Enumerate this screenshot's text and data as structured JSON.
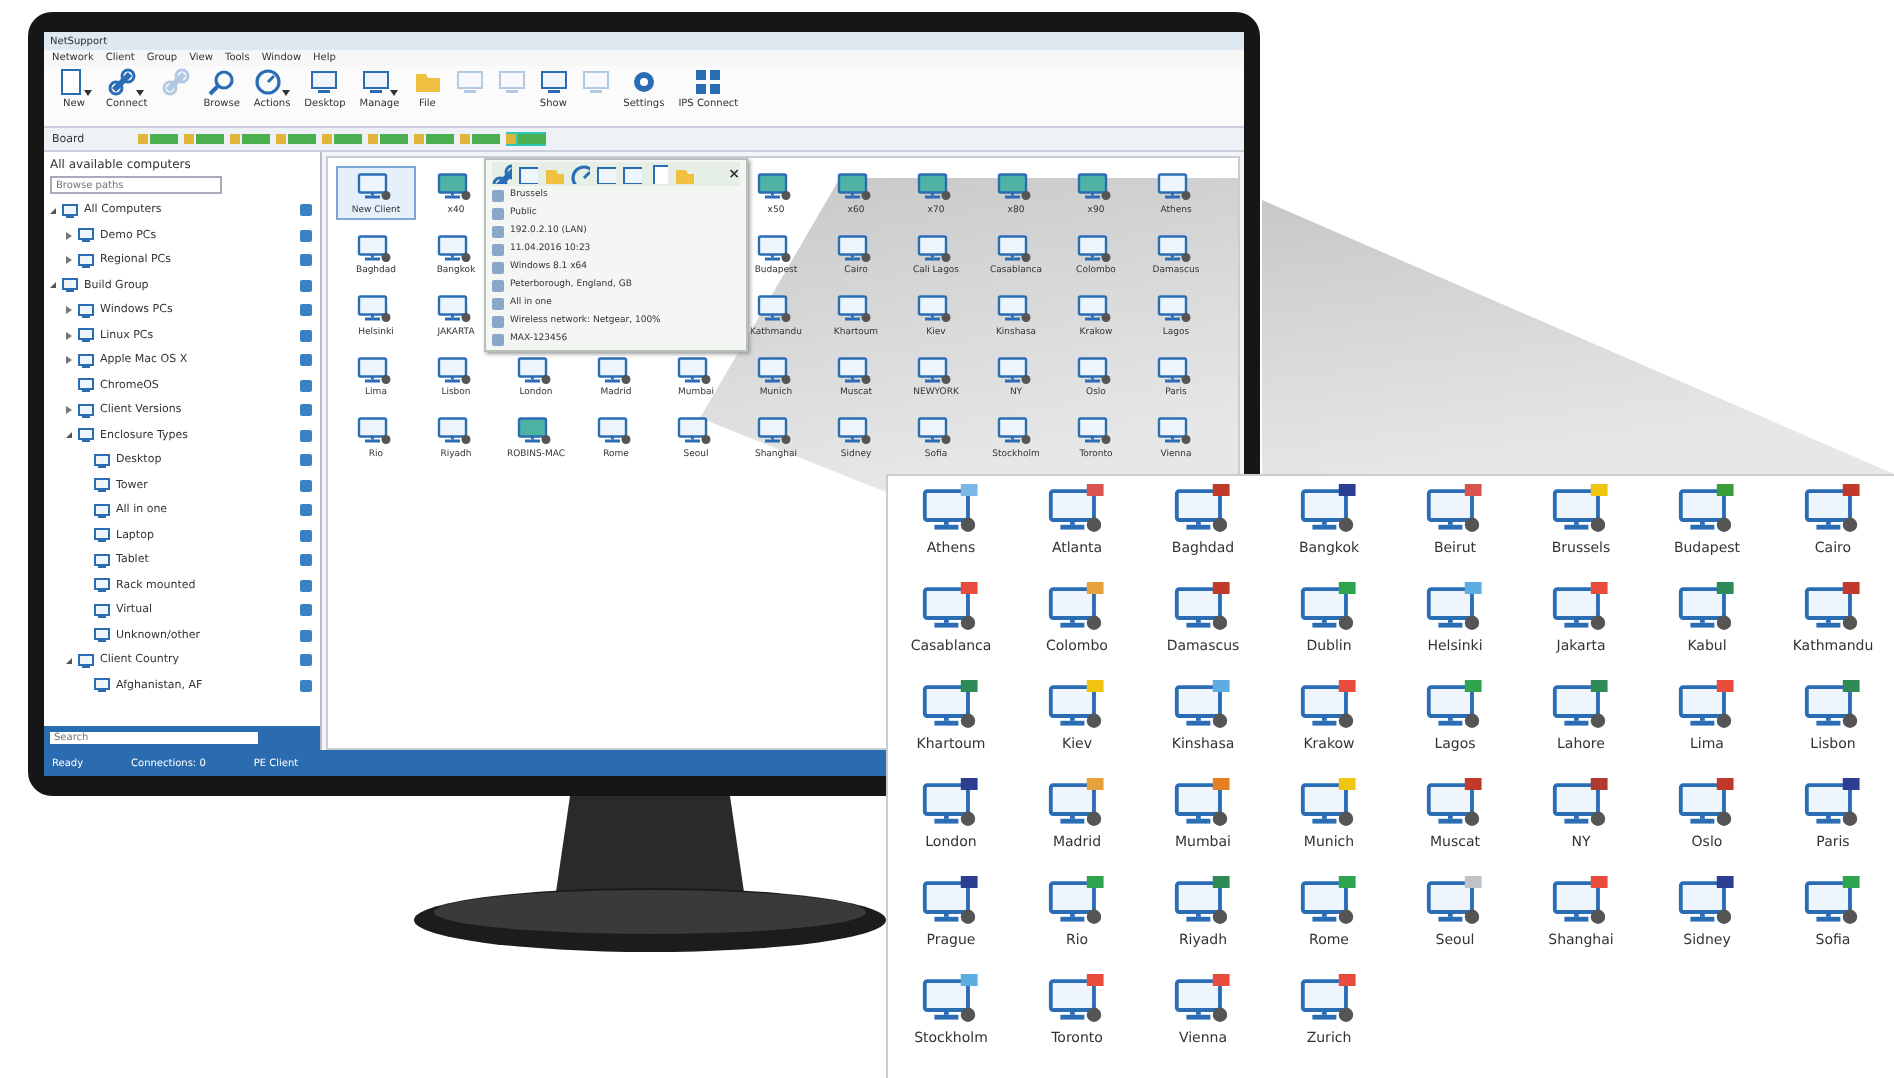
{
  "window": {
    "title": "NetSupport"
  },
  "menu": [
    "Network",
    "Client",
    "Group",
    "View",
    "Tools",
    "Window",
    "Help"
  ],
  "toolbar": [
    {
      "label": "New",
      "caret": true,
      "disabled": false
    },
    {
      "label": "Connect",
      "caret": true,
      "disabled": false
    },
    {
      "caret": false,
      "disabled": true
    },
    {
      "label": "Browse",
      "caret": false,
      "disabled": false
    },
    {
      "label": "Actions",
      "caret": true,
      "disabled": false
    },
    {
      "label": "Desktop",
      "caret": false,
      "disabled": false
    },
    {
      "label": "Manage",
      "caret": true,
      "disabled": false
    },
    {
      "label": "File",
      "caret": false,
      "disabled": false
    },
    {
      "caret": false,
      "disabled": true
    },
    {
      "caret": false,
      "disabled": true
    },
    {
      "label": "Show",
      "caret": false,
      "disabled": false
    },
    {
      "caret": false,
      "disabled": true
    },
    {
      "label": "Settings",
      "caret": false,
      "disabled": false
    },
    {
      "label": "IPS Connect",
      "caret": false,
      "disabled": false
    }
  ],
  "board": {
    "label": "Board",
    "chips": [
      {
        "selected": false
      },
      {
        "selected": false
      },
      {
        "selected": false
      },
      {
        "selected": false
      },
      {
        "selected": false
      },
      {
        "selected": false
      },
      {
        "selected": false
      },
      {
        "selected": false
      },
      {
        "selected": true
      }
    ]
  },
  "sidebar": {
    "title": "All available computers",
    "search": {
      "placeholder": "Browse paths"
    },
    "tree": [
      {
        "label": "All Computers",
        "expanded": true,
        "children": [
          {
            "label": "Demo PCs",
            "expanded": false
          },
          {
            "label": "Regional PCs",
            "expanded": false
          }
        ]
      },
      {
        "label": "Build Group",
        "expanded": true,
        "children": [
          {
            "label": "Windows PCs",
            "expanded": false
          },
          {
            "label": "Linux PCs",
            "expanded": false
          },
          {
            "label": "Apple Mac OS X",
            "expanded": false
          },
          {
            "label": "ChromeOS"
          },
          {
            "label": "Client Versions",
            "expanded": false
          },
          {
            "label": "Enclosure Types",
            "expanded": true,
            "children": [
              {
                "label": "Desktop"
              },
              {
                "label": "Tower"
              },
              {
                "label": "All in one"
              },
              {
                "label": "Laptop"
              },
              {
                "label": "Tablet"
              },
              {
                "label": "Rack mounted"
              },
              {
                "label": "Virtual"
              },
              {
                "label": "Unknown/other"
              }
            ]
          },
          {
            "label": "Client Country",
            "expanded": true,
            "children": [
              {
                "label": "Afghanistan, AF"
              }
            ]
          }
        ]
      }
    ],
    "bottom_search": {
      "placeholder": "Search"
    }
  },
  "grid": [
    {
      "left": [
        {
          "label": "New Client",
          "kind": "outline",
          "selected": true
        },
        {
          "label": "x40",
          "kind": "filled",
          "selected": false
        }
      ],
      "right": [
        {
          "label": "x50",
          "kind": "filled",
          "selected": false
        },
        {
          "label": "x60",
          "kind": "filled",
          "selected": false
        },
        {
          "label": "x70",
          "kind": "filled",
          "selected": false
        },
        {
          "label": "x80",
          "kind": "filled",
          "selected": false
        },
        {
          "label": "x90",
          "kind": "filled",
          "selected": false
        },
        {
          "label": "Athens",
          "kind": "outline",
          "selected": false
        }
      ]
    },
    {
      "left": [
        {
          "label": "Baghdad",
          "kind": "outline",
          "selected": false
        },
        {
          "label": "Bangkok",
          "kind": "outline",
          "selected": false
        }
      ],
      "right": [
        {
          "label": "Budapest",
          "kind": "outline",
          "selected": false
        },
        {
          "label": "Cairo",
          "kind": "outline",
          "selected": false
        },
        {
          "label": "Cali Lagos",
          "kind": "outline",
          "selected": false
        },
        {
          "label": "Casablanca",
          "kind": "outline",
          "selected": false
        },
        {
          "label": "Colombo",
          "kind": "outline",
          "selected": false
        },
        {
          "label": "Damascus",
          "kind": "outline",
          "selected": false
        }
      ]
    },
    {
      "left": [
        {
          "label": "Helsinki",
          "kind": "outline",
          "selected": false
        },
        {
          "label": "JAKARTA",
          "kind": "outline",
          "selected": false
        }
      ],
      "right": [
        {
          "label": "Kathmandu",
          "kind": "outline",
          "selected": false
        },
        {
          "label": "Khartoum",
          "kind": "outline",
          "selected": false
        },
        {
          "label": "Kiev",
          "kind": "outline",
          "selected": false
        },
        {
          "label": "Kinshasa",
          "kind": "outline",
          "selected": false
        },
        {
          "label": "Krakow",
          "kind": "outline",
          "selected": false
        },
        {
          "label": "Lagos",
          "kind": "outline",
          "selected": false
        }
      ]
    },
    {
      "cells": [
        {
          "label": "Lima",
          "kind": "outline",
          "selected": false
        },
        {
          "label": "Lisbon",
          "kind": "outline",
          "selected": false
        },
        {
          "label": "London",
          "kind": "outline",
          "selected": false
        },
        {
          "label": "Madrid",
          "kind": "outline",
          "selected": false
        },
        {
          "label": "Mumbai",
          "kind": "outline",
          "selected": false
        },
        {
          "label": "Munich",
          "kind": "outline",
          "selected": false
        },
        {
          "label": "Muscat",
          "kind": "outline",
          "selected": false
        },
        {
          "label": "NEWYORK",
          "kind": "outline",
          "selected": false
        },
        {
          "label": "NY",
          "kind": "outline",
          "selected": false
        },
        {
          "label": "Oslo",
          "kind": "outline",
          "selected": false
        },
        {
          "label": "Paris",
          "kind": "outline",
          "selected": false
        }
      ]
    },
    {
      "cells": [
        {
          "label": "Rio",
          "kind": "outline",
          "selected": false
        },
        {
          "label": "Riyadh",
          "kind": "outline",
          "selected": false
        },
        {
          "label": "ROBINS-MAC",
          "kind": "filled",
          "selected": false
        },
        {
          "label": "Rome",
          "kind": "outline",
          "selected": false
        },
        {
          "label": "Seoul",
          "kind": "outline",
          "selected": false
        },
        {
          "label": "Shanghai",
          "kind": "outline",
          "selected": false
        },
        {
          "label": "Sidney",
          "kind": "outline",
          "selected": false
        },
        {
          "label": "Sofia",
          "kind": "outline",
          "selected": false
        },
        {
          "label": "Stockholm",
          "kind": "outline",
          "selected": false
        },
        {
          "label": "Toronto",
          "kind": "outline",
          "selected": false
        },
        {
          "label": "Vienna",
          "kind": "outline",
          "selected": false
        }
      ]
    }
  ],
  "tooltip": {
    "close": "×",
    "lines": [
      "Brussels",
      "Public",
      "192.0.2.10 (LAN)",
      "11.04.2016 10:23",
      "Windows 8.1 x64",
      "Peterborough, England, GB",
      "All in one",
      "Wireless network: Netgear, 100%",
      "MAX-123456"
    ]
  },
  "status_bar": [
    "Ready",
    "Connections: 0",
    "PE Client"
  ],
  "zoom_panel": [
    {
      "label": "Athens",
      "color": "#7ab8e8"
    },
    {
      "label": "Atlanta",
      "color": "#d9534f"
    },
    {
      "label": "Baghdad",
      "color": "#c0392b"
    },
    {
      "label": "Bangkok",
      "color": "#2c3e91"
    },
    {
      "label": "Beirut",
      "color": "#d9534f"
    },
    {
      "label": "Brussels",
      "color": "#f1c40f"
    },
    {
      "label": "Budapest",
      "color": "#3a9d3a"
    },
    {
      "label": "Cairo",
      "color": "#c0392b"
    },
    {
      "label": "Casablanca",
      "color": "#e74c3c"
    },
    {
      "label": "Colombo",
      "color": "#e6a23c"
    },
    {
      "label": "Damascus",
      "color": "#c0392b"
    },
    {
      "label": "Dublin",
      "color": "#2ea44f"
    },
    {
      "label": "Helsinki",
      "color": "#5dade2"
    },
    {
      "label": "Jakarta",
      "color": "#e74c3c"
    },
    {
      "label": "Kabul",
      "color": "#2e8b57"
    },
    {
      "label": "Kathmandu",
      "color": "#c0392b"
    },
    {
      "label": "Khartoum",
      "color": "#2e8b57"
    },
    {
      "label": "Kiev",
      "color": "#f1c40f"
    },
    {
      "label": "Kinshasa",
      "color": "#5dade2"
    },
    {
      "label": "Krakow",
      "color": "#e74c3c"
    },
    {
      "label": "Lagos",
      "color": "#2ea44f"
    },
    {
      "label": "Lahore",
      "color": "#2e8b57"
    },
    {
      "label": "Lima",
      "color": "#e74c3c"
    },
    {
      "label": "Lisbon",
      "color": "#2e8b57"
    },
    {
      "label": "London",
      "color": "#2c3e91"
    },
    {
      "label": "Madrid",
      "color": "#e6a23c"
    },
    {
      "label": "Mumbai",
      "color": "#e67e22"
    },
    {
      "label": "Munich",
      "color": "#f1c40f"
    },
    {
      "label": "Muscat",
      "color": "#c0392b"
    },
    {
      "label": "NY",
      "color": "#b03a2e"
    },
    {
      "label": "Oslo",
      "color": "#c0392b"
    },
    {
      "label": "Paris",
      "color": "#2c3e91"
    },
    {
      "label": "Prague",
      "color": "#2c3e91"
    },
    {
      "label": "Rio",
      "color": "#2ea44f"
    },
    {
      "label": "Riyadh",
      "color": "#2e8b57"
    },
    {
      "label": "Rome",
      "color": "#2ea44f"
    },
    {
      "label": "Seoul",
      "color": "#bdc3c7"
    },
    {
      "label": "Shanghai",
      "color": "#e74c3c"
    },
    {
      "label": "Sidney",
      "color": "#2c3e91"
    },
    {
      "label": "Sofia",
      "color": "#2ea44f"
    },
    {
      "label": "Stockholm",
      "color": "#5dade2"
    },
    {
      "label": "Toronto",
      "color": "#e74c3c"
    },
    {
      "label": "Vienna",
      "color": "#e74c3c"
    },
    {
      "label": "Zurich",
      "color": "#e74c3c"
    }
  ]
}
